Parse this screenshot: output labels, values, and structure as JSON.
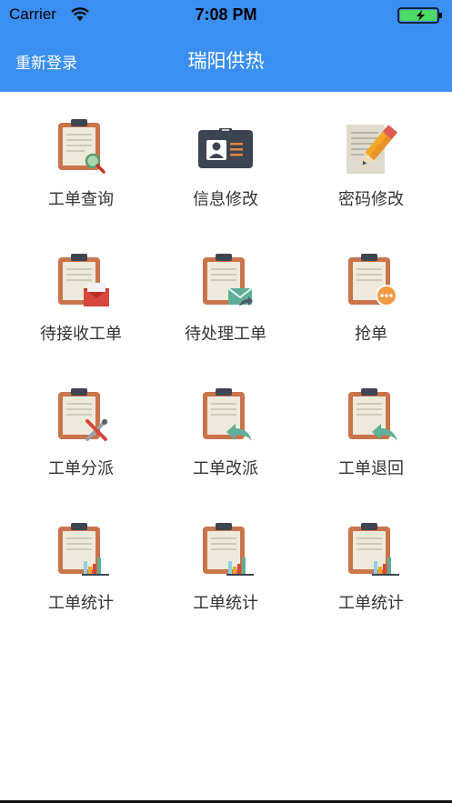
{
  "status_bar": {
    "carrier": "Carrier",
    "time": "7:08 PM"
  },
  "nav": {
    "back_label": "重新登录",
    "title": "瑞阳供热"
  },
  "colors": {
    "nav_blue": "#3a8ff0",
    "clip_orange": "#c9744a",
    "paper": "#eeeadb",
    "battery_green": "#4cd964"
  },
  "grid": [
    {
      "label": "工单查询",
      "icon": "magnifier-icon"
    },
    {
      "label": "信息修改",
      "icon": "id-card-icon"
    },
    {
      "label": "密码修改",
      "icon": "pencil-note-icon"
    },
    {
      "label": "待接收工单",
      "icon": "mail-icon"
    },
    {
      "label": "待处理工单",
      "icon": "forward-mail-icon"
    },
    {
      "label": "抢单",
      "icon": "more-dots-icon"
    },
    {
      "label": "工单分派",
      "icon": "tools-icon"
    },
    {
      "label": "工单改派",
      "icon": "return-arrow-icon"
    },
    {
      "label": "工单退回",
      "icon": "return-arrow-icon"
    },
    {
      "label": "工单统计",
      "icon": "bar-chart-icon"
    },
    {
      "label": "工单统计",
      "icon": "bar-chart-icon"
    },
    {
      "label": "工单统计",
      "icon": "bar-chart-icon"
    }
  ]
}
